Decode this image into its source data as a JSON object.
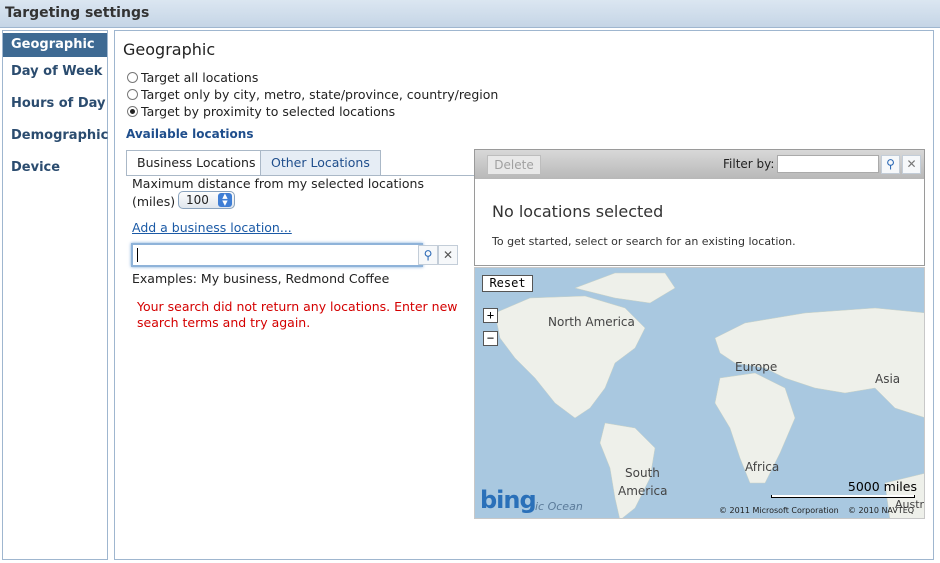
{
  "title": "Targeting settings",
  "sidebar": {
    "items": [
      {
        "label": "Geographic"
      },
      {
        "label": "Day of Week"
      },
      {
        "label": "Hours of Day"
      },
      {
        "label": "Demographic"
      },
      {
        "label": "Device"
      }
    ]
  },
  "main": {
    "heading": "Geographic",
    "radios": [
      {
        "label": "Target all locations",
        "selected": false
      },
      {
        "label": "Target only by city, metro, state/province, country/region",
        "selected": false
      },
      {
        "label": "Target by proximity to selected locations",
        "selected": true
      }
    ],
    "available_label": "Available locations",
    "tabs": [
      {
        "label": "Business Locations"
      },
      {
        "label": "Other Locations"
      }
    ],
    "max_distance_label_1": "Maximum distance from my selected locations",
    "max_distance_label_2": "(miles)",
    "distance_value": "100",
    "add_link": "Add a business location...",
    "search_value": "",
    "examples": "Examples: My business, Redmond Coffee",
    "error_text": "Your search did not return any locations. Enter new search terms and try again."
  },
  "right_panel": {
    "delete_label": "Delete",
    "filter_label": "Filter by:",
    "filter_value": "",
    "no_locations": "No locations selected",
    "get_started": "To get started, select or search for an existing location."
  },
  "map": {
    "reset_label": "Reset",
    "zoom_in": "+",
    "zoom_out": "−",
    "labels": {
      "north_america": "North America",
      "europe": "Europe",
      "asia": "Asia",
      "africa": "Africa",
      "south": "South",
      "america": "America",
      "ocean": "ic Ocean",
      "austr": "Austr"
    },
    "scale_label": "5000 miles",
    "logo": "bing",
    "copyright_ms": "© 2011 Microsoft Corporation",
    "copyright_navteq": "© 2010 NAVTEQ",
    "colors": {
      "water": "#a9c8e0",
      "land": "#eef0ea"
    }
  }
}
